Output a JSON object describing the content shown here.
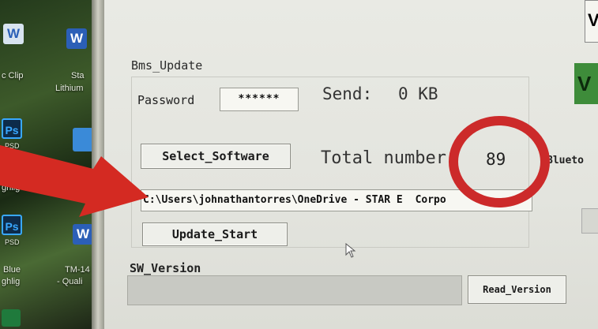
{
  "desktop": {
    "icons": [
      {
        "label": "c Clip",
        "icon": "word-doc-icon"
      },
      {
        "label": "Sta",
        "icon": "word-icon"
      },
      {
        "label": "Lithium",
        "icon": "word-icon"
      },
      {
        "label": "Ps",
        "icon": "photoshop-icon"
      },
      {
        "label": "PSD",
        "icon": "photoshop-icon"
      },
      {
        "label": "ghlig",
        "icon": "photoshop-icon"
      },
      {
        "label": "Ps",
        "icon": "photoshop-icon"
      },
      {
        "label": "PSD",
        "icon": "photoshop-icon"
      },
      {
        "label": "Blue",
        "icon": "photoshop-icon"
      },
      {
        "label": "ghlig",
        "icon": "photoshop-icon"
      },
      {
        "label": "W",
        "icon": "word-icon"
      },
      {
        "label": "TM-14",
        "icon": "word-icon"
      },
      {
        "label": "- Quali",
        "icon": "word-icon"
      }
    ]
  },
  "app": {
    "group_title": "Bms_Update",
    "password_label": "Password",
    "password_value": "******",
    "send_label": "Send:",
    "send_value": "0 KB",
    "select_software_label": "Select_Software",
    "total_number_label": "Total number:",
    "total_number_value": "89",
    "bluetooth_label": "Blueto",
    "file_path": "C:\\Users\\johnathantorres\\OneDrive - STAR E",
    "file_path_tail": "Corpo",
    "update_start_label": "Update_Start",
    "sw_version_label": "SW_Version",
    "sw_version_value": "",
    "read_version_label": "Read_Version",
    "green_badge": "V",
    "top_right_badge": "V"
  },
  "annotations": {
    "arrow_color": "#d42a22",
    "circle_color": "#cc2a2a"
  }
}
